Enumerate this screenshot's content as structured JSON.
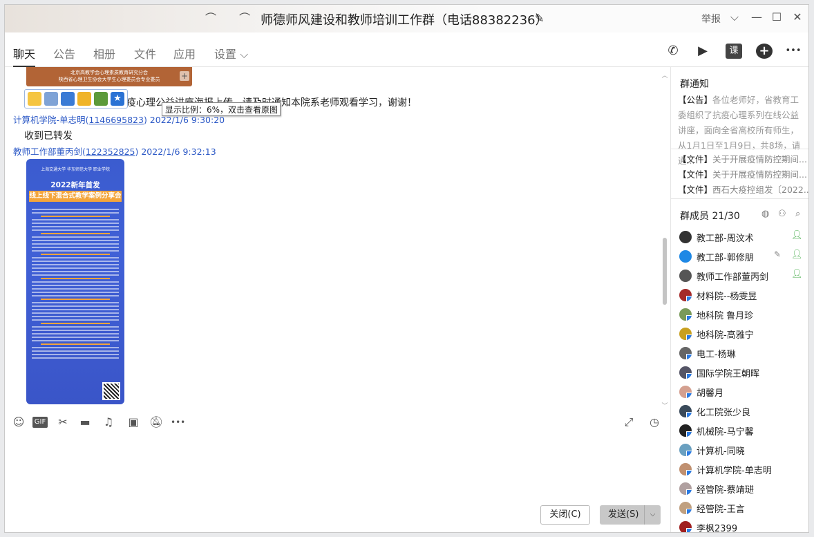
{
  "window": {
    "title": "师德师风建设和教师培训工作群（电话88382236）",
    "report_label": "举报",
    "edit_icon": "pencil-icon",
    "controls": [
      "chevron-down-icon",
      "minimize-icon",
      "maximize-icon",
      "close-icon"
    ]
  },
  "tabs": [
    {
      "label": "聊天",
      "active": true
    },
    {
      "label": "公告"
    },
    {
      "label": "相册"
    },
    {
      "label": "文件"
    },
    {
      "label": "应用"
    },
    {
      "label": "设置 ⌵"
    }
  ],
  "header_actions": {
    "voice_call": "phone-icon",
    "video_call": "video-icon",
    "course": "课",
    "add": "+",
    "more": "•••"
  },
  "chat": {
    "banner_text": "北京高教学会心理素质教育研究分会\n陕西省心理卫生协会大学生心理委员会专业委员",
    "partial_message": "疫心理公益讲座海报上传，请及时通知本院系老师观看学习，谢谢！",
    "tooltip": "显示比例：6%，双击查看原图",
    "messages": [
      {
        "sender": "计算机学院-单志明",
        "qq": "1146695823",
        "time": "2022/1/6 9:30:20",
        "text": "收到已转发"
      },
      {
        "sender": "教师工作部董丙剑",
        "qq": "122352825",
        "time": "2022/1/6 9:32:13"
      }
    ],
    "poster": {
      "header": "上海交通大学  华东师范大学  职业学院",
      "title": "2022新年首发",
      "subtitle": "线上线下混合式教学案例分享会"
    }
  },
  "input": {
    "toolbar": [
      "emoji-icon",
      "GIF",
      "scissors-icon",
      "folder-icon",
      "music-icon",
      "image-icon",
      "mute-bell-icon",
      "•••"
    ],
    "close_label": "关闭(C)",
    "send_label": "发送(S)"
  },
  "notice": {
    "title": "群通知",
    "tag": "【公告】",
    "text": "各位老师好，省教育工委组织了抗疫心理系列在线公益讲座，面向全省高校所有师生，从1月1日至1月9日，共8场，请通...",
    "files": [
      {
        "tag": "【文件】",
        "name": "关于开展疫情防控期间..."
      },
      {
        "tag": "【文件】",
        "name": "关于开展疫情防控期间..."
      },
      {
        "tag": "【文件】",
        "name": "西石大疫控组发〔2022..."
      }
    ]
  },
  "members": {
    "title": "群成员 21/30",
    "list": [
      {
        "name": "教工部-周汶术",
        "admin": true,
        "color": "#333"
      },
      {
        "name": "教工部-郭修朋",
        "admin": true,
        "pen": true,
        "color": "#1e88e5"
      },
      {
        "name": "教师工作部董丙剑",
        "admin": true,
        "color": "#555"
      },
      {
        "name": "材料院--杨雯昱",
        "color": "#a52a2a"
      },
      {
        "name": "地科院 鲁月珍",
        "color": "#7a9a5a"
      },
      {
        "name": "地科院-高雅宁",
        "color": "#c8a020"
      },
      {
        "name": "电工-杨琳",
        "color": "#666"
      },
      {
        "name": "国际学院王朝晖",
        "color": "#556"
      },
      {
        "name": "胡馨月",
        "color": "#d4a090"
      },
      {
        "name": "化工院张少良",
        "color": "#3a4a5a"
      },
      {
        "name": "机械院-马宁馨",
        "color": "#222"
      },
      {
        "name": "计算机-同晓",
        "color": "#6aa0c0"
      },
      {
        "name": "计算机学院-单志明",
        "color": "#c09070"
      },
      {
        "name": "经管院-蔡靖琎",
        "color": "#b0a0a0"
      },
      {
        "name": "经管院-王言",
        "color": "#c0a080"
      },
      {
        "name": "李枫2399",
        "color": "#a02020"
      }
    ]
  }
}
